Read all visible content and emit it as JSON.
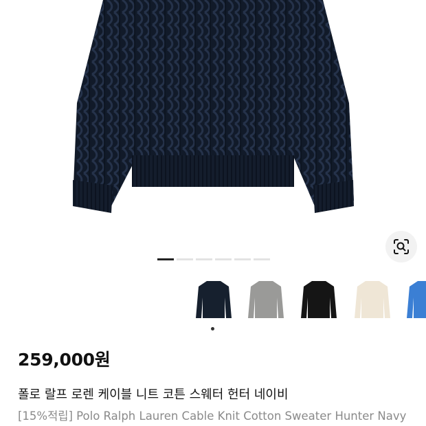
{
  "product": {
    "price": "259,000원",
    "title_ko": "폴로 랄프 로렌 케이블 니트 코튼 스웨터 헌터 네이비",
    "title_en": "[15%적립] Polo Ralph Lauren Cable Knit Cotton Sweater Hunter Navy"
  },
  "gallery": {
    "page_count": 6,
    "active_page": 1
  },
  "variants": [
    {
      "color_name": "navy",
      "color": "#16202e"
    },
    {
      "color_name": "gray",
      "color": "#9a9a98"
    },
    {
      "color_name": "black",
      "color": "#151515"
    },
    {
      "color_name": "cream",
      "color": "#efe6d6"
    },
    {
      "color_name": "blue",
      "color": "#3b7fd4"
    }
  ],
  "icons": {
    "lens": "image-search-icon"
  }
}
